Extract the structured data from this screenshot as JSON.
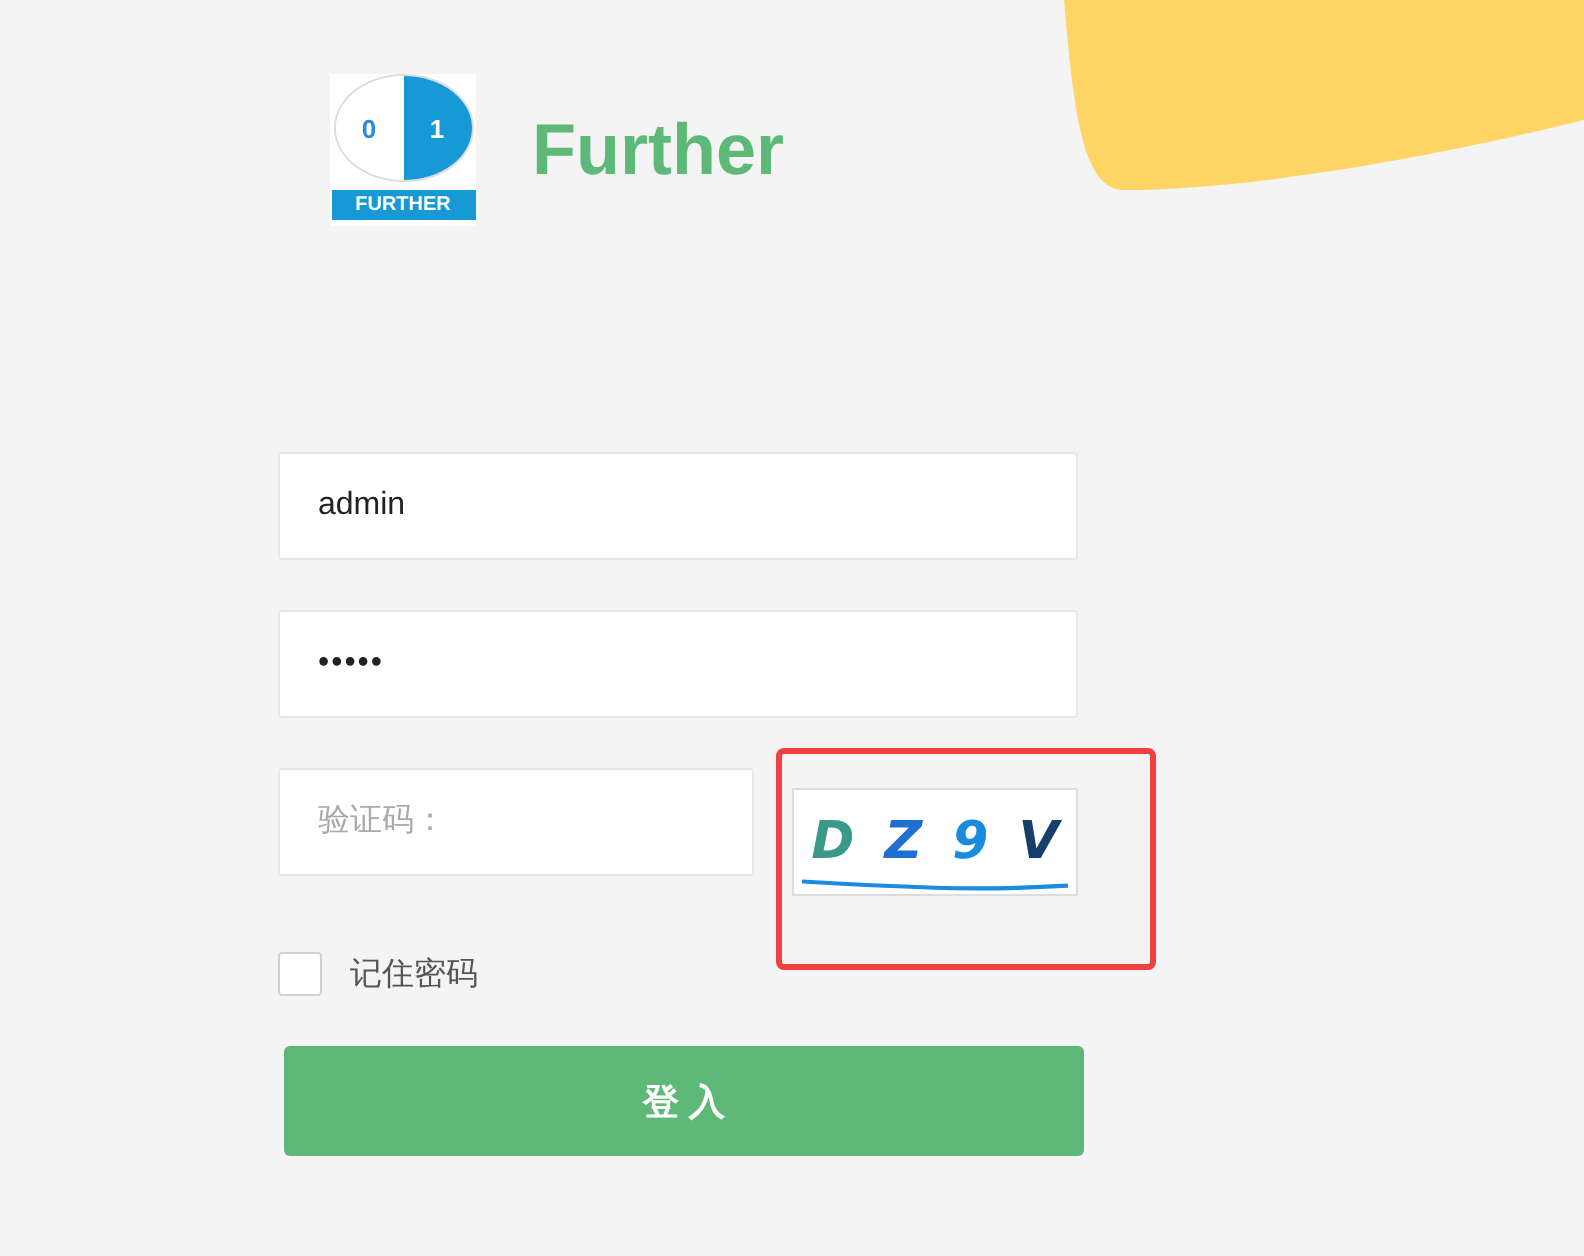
{
  "logo": {
    "left_digit": "0",
    "right_digit": "1",
    "caption": "FURTHER"
  },
  "brand": "Further",
  "username": {
    "value": "admin"
  },
  "password": {
    "value": "•••••"
  },
  "captcha": {
    "placeholder": "验证码：",
    "code": "D Z 9 V"
  },
  "remember": {
    "label": "记住密码",
    "checked": false
  },
  "login_button": "登 入"
}
